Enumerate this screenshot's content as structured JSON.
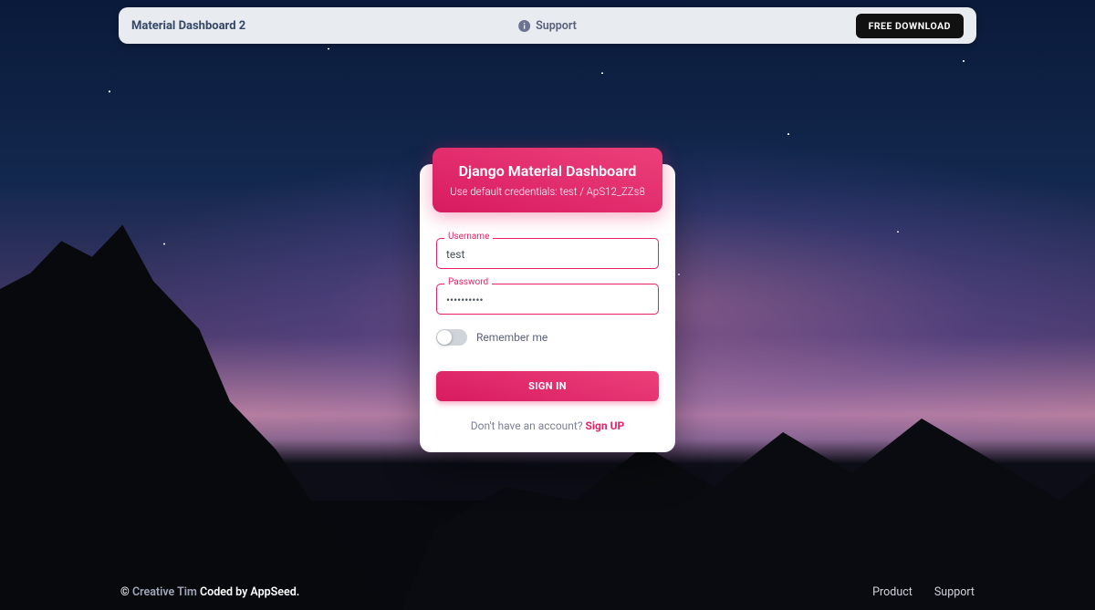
{
  "topbar": {
    "brand": "Material Dashboard 2",
    "support_label": "Support",
    "download_label": "FREE DOWNLOAD"
  },
  "card": {
    "title": "Django Material Dashboard",
    "subtitle": "Use default credentials: test / ApS12_ZZs8",
    "username_label": "Username",
    "username_value": "test",
    "password_label": "Password",
    "password_value": "••••••••••",
    "remember_label": "Remember me",
    "signin_label": "SIGN IN",
    "signup_prompt": "Don't have an account? ",
    "signup_link": "Sign UP"
  },
  "footer": {
    "copyright_symbol": "©",
    "brand_link": "Creative Tim",
    "coded_by": " Coded by AppSeed.",
    "links": [
      "Product",
      "Support"
    ]
  },
  "colors": {
    "primary": "#e91e63",
    "dark_btn": "#111111"
  }
}
